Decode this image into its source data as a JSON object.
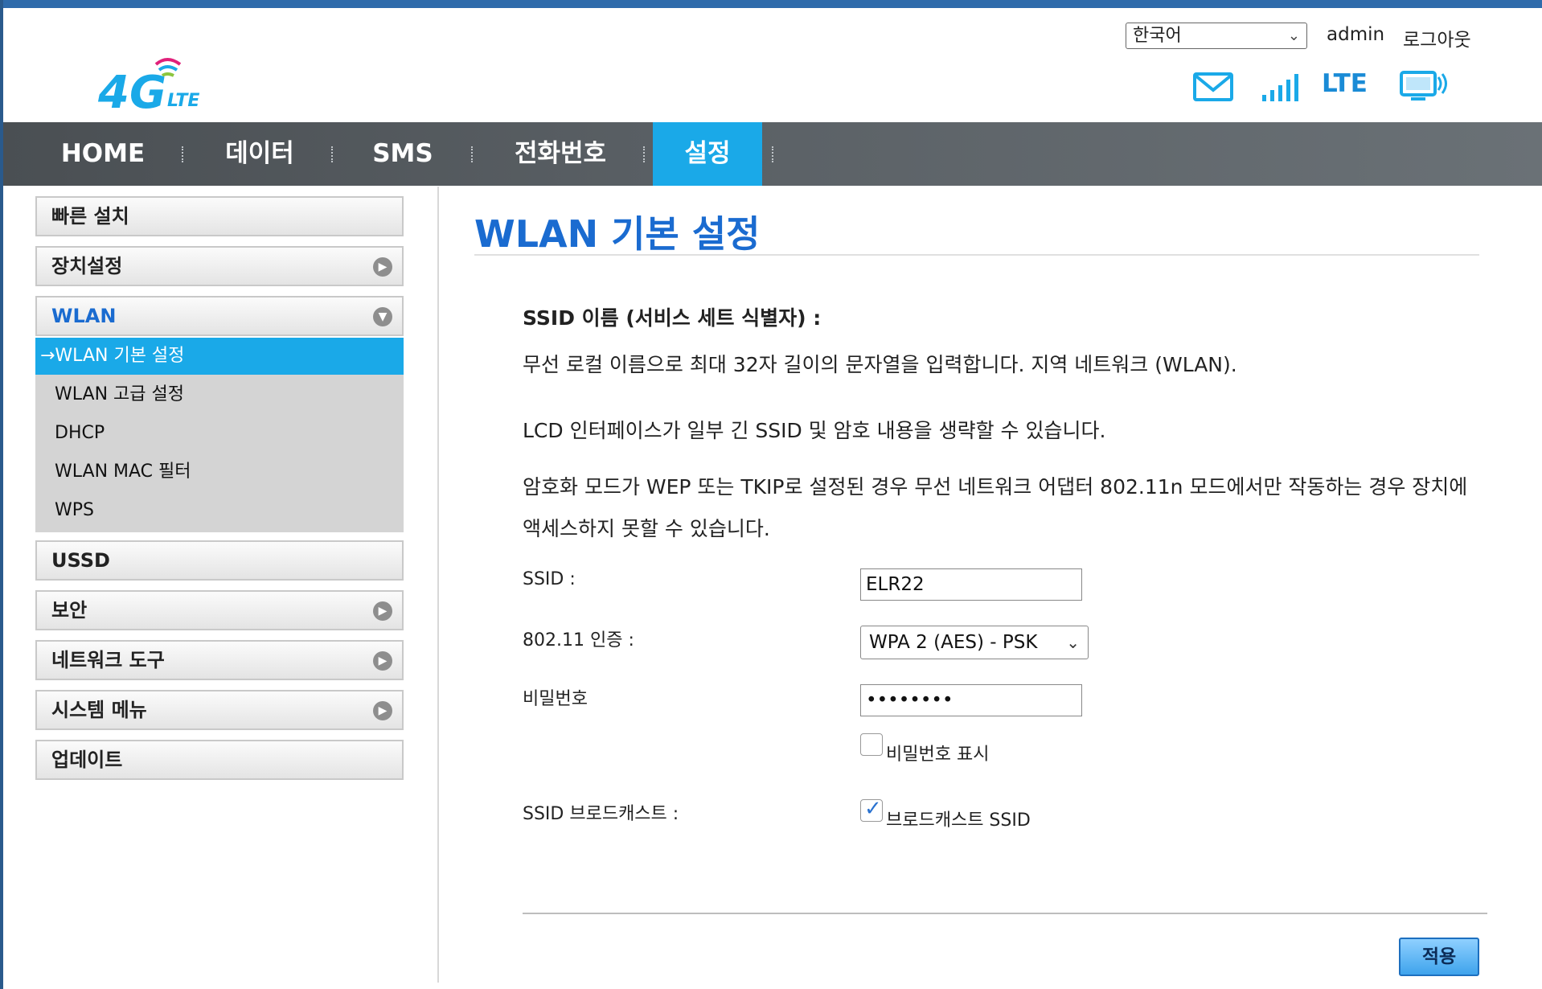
{
  "header": {
    "logo_text": "4G",
    "logo_sub": "LTE",
    "language": "한국어",
    "user": "admin",
    "logout": "로그아웃",
    "network_type": "LTE",
    "icons": [
      "mail-icon",
      "signal-icon",
      "monitor-icon"
    ]
  },
  "nav": {
    "items": [
      "HOME",
      "데이터",
      "SMS",
      "전화번호",
      "설정"
    ],
    "active": "설정"
  },
  "sidebar": {
    "items": [
      {
        "label": "빠른 설치"
      },
      {
        "label": "장치설정"
      },
      {
        "label": "WLAN"
      },
      {
        "label": "USSD"
      },
      {
        "label": "보안"
      },
      {
        "label": "네트워크 도구"
      },
      {
        "label": "시스템 메뉴"
      },
      {
        "label": "업데이트"
      }
    ],
    "submenu": [
      "→WLAN 기본 설정",
      "WLAN 고급 설정",
      "DHCP",
      "WLAN MAC 필터",
      "WPS"
    ]
  },
  "main": {
    "title": "WLAN 기본 설정",
    "desc_heading": "SSID 이름 (서비스 세트 식별자) :",
    "desc1": "무선 로컬 이름으로 최대 32자 길이의 문자열을 입력합니다. 지역 네트워크 (WLAN).",
    "desc2": "LCD 인터페이스가 일부 긴 SSID 및 암호 내용을 생략할 수 있습니다.",
    "desc3": "암호화 모드가 WEP 또는 TKIP로 설정된 경우 무선 네트워크 어댑터 802.11n 모드에서만 작동하는 경우 장치에 액세스하지 못할 수 있습니다.",
    "ssid_label": "SSID :",
    "ssid_value": "ELR22",
    "auth_label": "802.11 인증 :",
    "auth_value": "WPA 2 (AES) - PSK",
    "password_label": "비밀번호",
    "password_value": "••••••••",
    "show_password_label": "비밀번호 표시",
    "broadcast_label": "SSID 브로드캐스트 :",
    "broadcast_checkbox_label": "브로드캐스트 SSID",
    "apply_label": "적용"
  },
  "colors": {
    "accent": "#1aa9e8",
    "title_blue": "#1a6bd0",
    "nav_bg": "#5a6065"
  }
}
